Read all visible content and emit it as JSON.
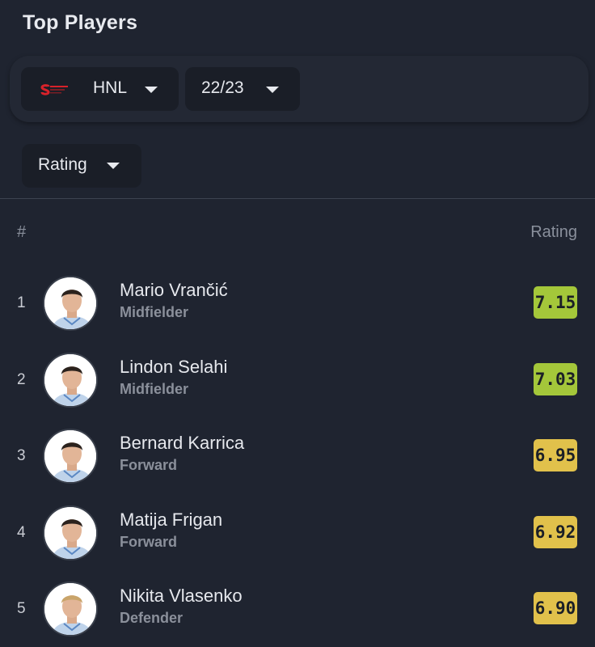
{
  "header": {
    "title": "Top Players"
  },
  "filters": {
    "league": "HNL",
    "season": "22/23",
    "stat": "Rating"
  },
  "table": {
    "rank_header": "#",
    "rating_header": "Rating",
    "colors": {
      "high": "#a4c73a",
      "mid": "#e1c14b"
    },
    "players": [
      {
        "rank": "1",
        "name": "Mario Vrančić",
        "position": "Midfielder",
        "rating": "7.15",
        "tier": "high"
      },
      {
        "rank": "2",
        "name": "Lindon Selahi",
        "position": "Midfielder",
        "rating": "7.03",
        "tier": "high"
      },
      {
        "rank": "3",
        "name": "Bernard Karrica",
        "position": "Forward",
        "rating": "6.95",
        "tier": "mid"
      },
      {
        "rank": "4",
        "name": "Matija Frigan",
        "position": "Forward",
        "rating": "6.92",
        "tier": "mid"
      },
      {
        "rank": "5",
        "name": "Nikita Vlasenko",
        "position": "Defender",
        "rating": "6.90",
        "tier": "mid"
      }
    ]
  }
}
